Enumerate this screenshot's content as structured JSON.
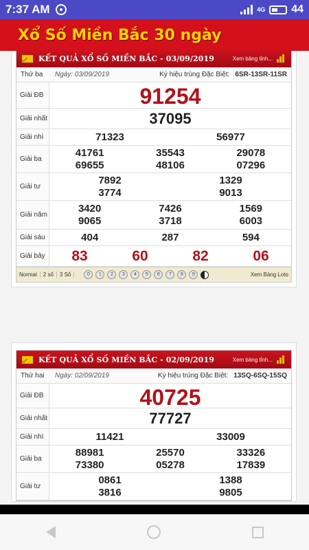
{
  "status": {
    "time": "7:37 AM",
    "network": "4G",
    "battery": "44"
  },
  "app": {
    "title": "Xổ Số Miền Bắc 30 ngày"
  },
  "labels": {
    "db": "Giải ĐB",
    "g1": "Giải nhất",
    "g2": "Giải nhì",
    "g3": "Giải ba",
    "g4": "Giải tư",
    "g5": "Giải năm",
    "g6": "Giải sáu",
    "g7": "Giải bảy",
    "symbol": "Ký hiệu trúng Đặc Biệt:"
  },
  "results": [
    {
      "title": "KẾT QUẢ XỔ SỐ MIỀN BẮC - 03/09/2019",
      "table_link": "Xem bảng tỉnh...",
      "dow": "Thứ ba",
      "date": "Ngày: 03/09/2019",
      "symbol": "6SR-13SR-11SR",
      "db": [
        "91254"
      ],
      "g1": [
        "37095"
      ],
      "g2": [
        "71323",
        "56977"
      ],
      "g3": [
        "41761",
        "35543",
        "29078",
        "69655",
        "48106",
        "07296"
      ],
      "g4": [
        "7892",
        "1329",
        "3774",
        "9013"
      ],
      "g5": [
        "3420",
        "7426",
        "1569",
        "9065",
        "3718",
        "6003"
      ],
      "g6": [
        "404",
        "287",
        "594"
      ],
      "g7": [
        "83",
        "60",
        "82",
        "06"
      ],
      "footer": {
        "normal": "Normal",
        "two": "2 số",
        "three": "3 Số",
        "digits": [
          "0",
          "1",
          "2",
          "3",
          "4",
          "5",
          "6",
          "7",
          "8",
          "9"
        ],
        "loto": "Xem Bảng Loto"
      }
    },
    {
      "title": "KẾT QUẢ XỔ SỐ MIỀN BẮC - 02/09/2019",
      "table_link": "Xem bảng tỉnh...",
      "dow": "Thứ hai",
      "date": "Ngày: 02/09/2019",
      "symbol": "13SQ-6SQ-15SQ",
      "db": [
        "40725"
      ],
      "g1": [
        "77727"
      ],
      "g2": [
        "11421",
        "33009"
      ],
      "g3": [
        "88981",
        "25570",
        "33326",
        "73380",
        "05278",
        "17839"
      ],
      "g4": [
        "0861",
        "1388",
        "3816",
        "9805"
      ]
    }
  ]
}
